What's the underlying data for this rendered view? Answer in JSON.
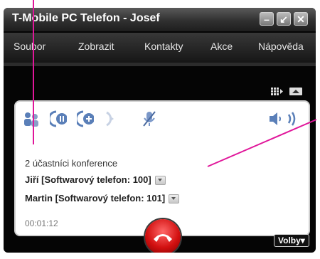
{
  "window": {
    "title": "T-Mobile PC Telefon - Josef"
  },
  "window_buttons": [
    "minimize-icon",
    "restore-icon",
    "close-icon"
  ],
  "menu": [
    "Soubor",
    "Zobrazit",
    "Kontakty",
    "Akce",
    "Nápověda"
  ],
  "toolbar_icons": [
    "participants-icon",
    "hold-icon",
    "add-call-icon",
    "forward-icon",
    "mute-microphone-icon",
    "speaker-icon",
    "volume-icon"
  ],
  "conference": {
    "label": "2 účastníci konference",
    "participants": [
      {
        "name": "Jiří [Softwarový telefon: 100]"
      },
      {
        "name": "Martin [Softwarový telefon: 101]"
      }
    ],
    "timer": "00:01:12"
  },
  "options_button": "Volby",
  "colors": {
    "callout": "#e0169a",
    "hangup": "#d21010",
    "window_bg": "#050505",
    "accent_icon": "#5a7fb8"
  }
}
